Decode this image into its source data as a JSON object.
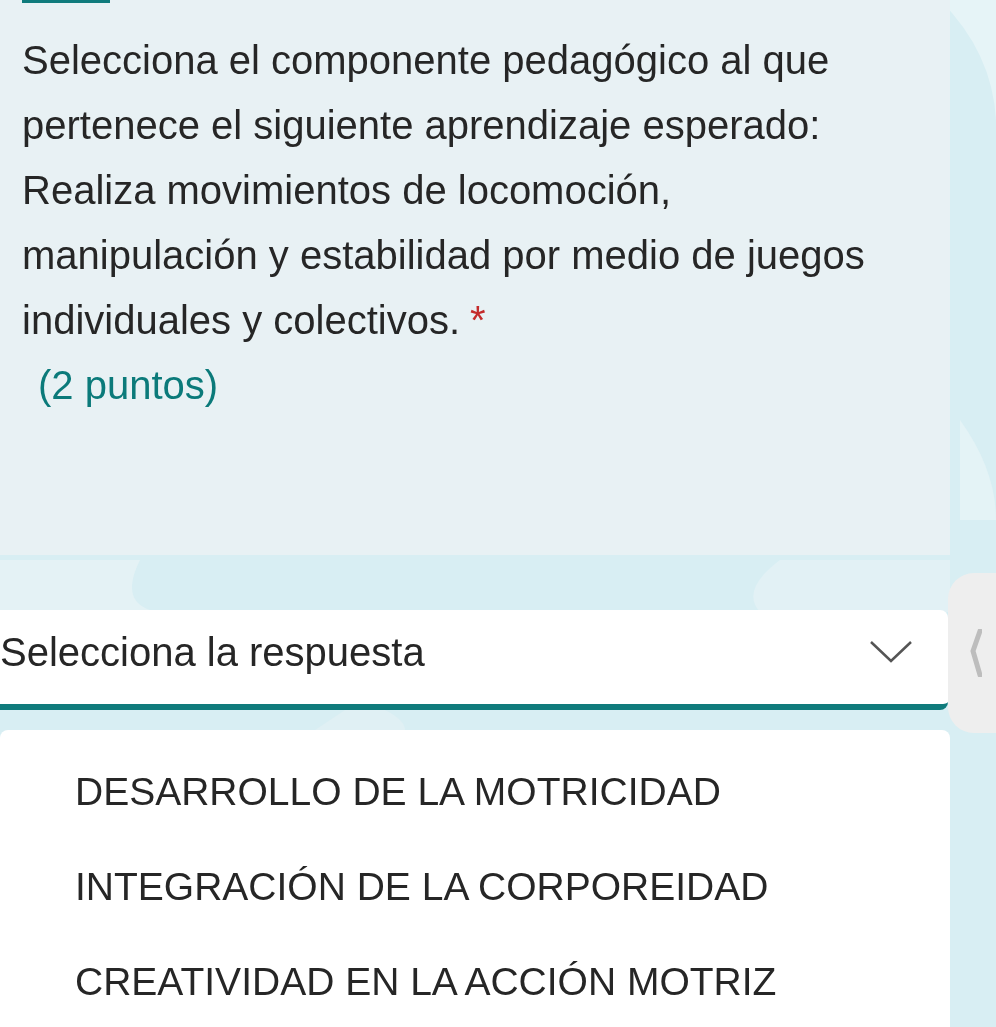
{
  "question": {
    "text": "Selecciona el componente pedagógico al que pertenece el siguiente aprendizaje esperado:\nRealiza movimientos de locomoción, manipulación y estabilidad por medio de juegos individuales y colectivos.",
    "required": true,
    "required_mark": "*",
    "points": "(2 puntos)"
  },
  "dropdown": {
    "placeholder": "Selecciona la respuesta",
    "expanded": true
  },
  "options": [
    {
      "label": "DESARROLLO DE LA MOTRICIDAD"
    },
    {
      "label": "INTEGRACIÓN DE LA CORPOREIDAD"
    },
    {
      "label": "CREATIVIDAD EN LA ACCIÓN MOTRIZ"
    }
  ]
}
